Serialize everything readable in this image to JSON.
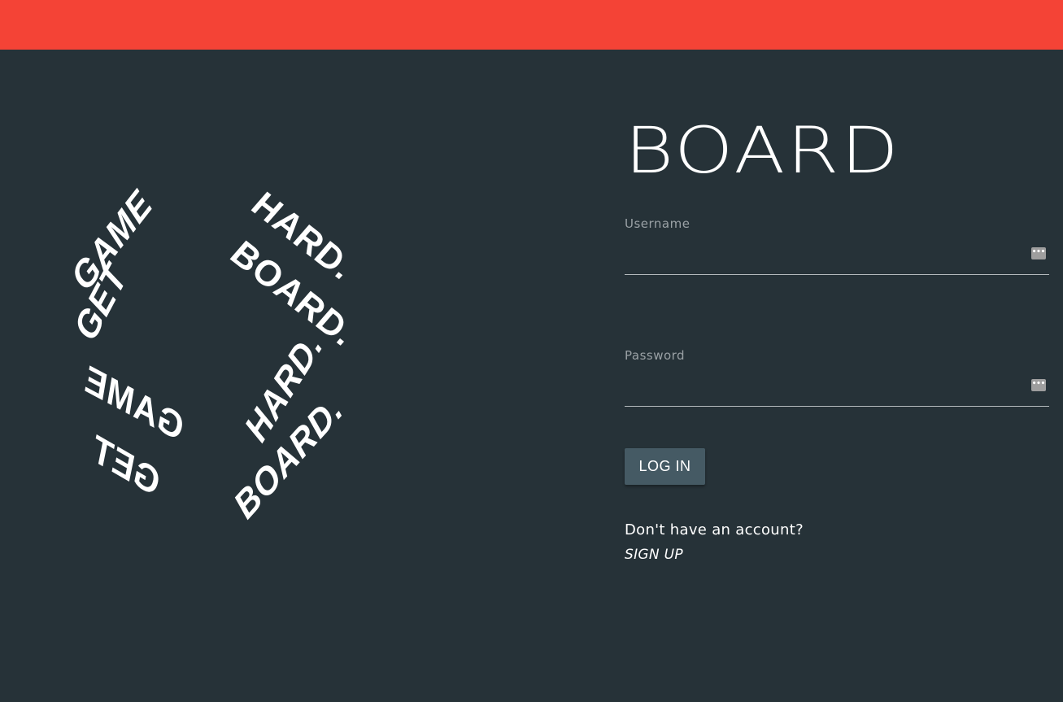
{
  "header": {
    "color": "#f44336"
  },
  "art": {
    "left_words": [
      "GAME",
      "GET",
      "GAME",
      "GET"
    ],
    "right_words": [
      "HARD.",
      "BOARD.",
      "HARD.",
      "BOARD."
    ]
  },
  "login": {
    "brand": "BOARD",
    "username_label": "Username",
    "username_value": "",
    "password_label": "Password",
    "password_value": "",
    "password_manager_icon": "key-icon",
    "login_button": "LOG IN",
    "signup_prompt": "Don't have an account?",
    "signup_link": "SIGN UP"
  },
  "colors": {
    "background": "#263238",
    "button": "#455a64",
    "accent": "#f44336"
  }
}
